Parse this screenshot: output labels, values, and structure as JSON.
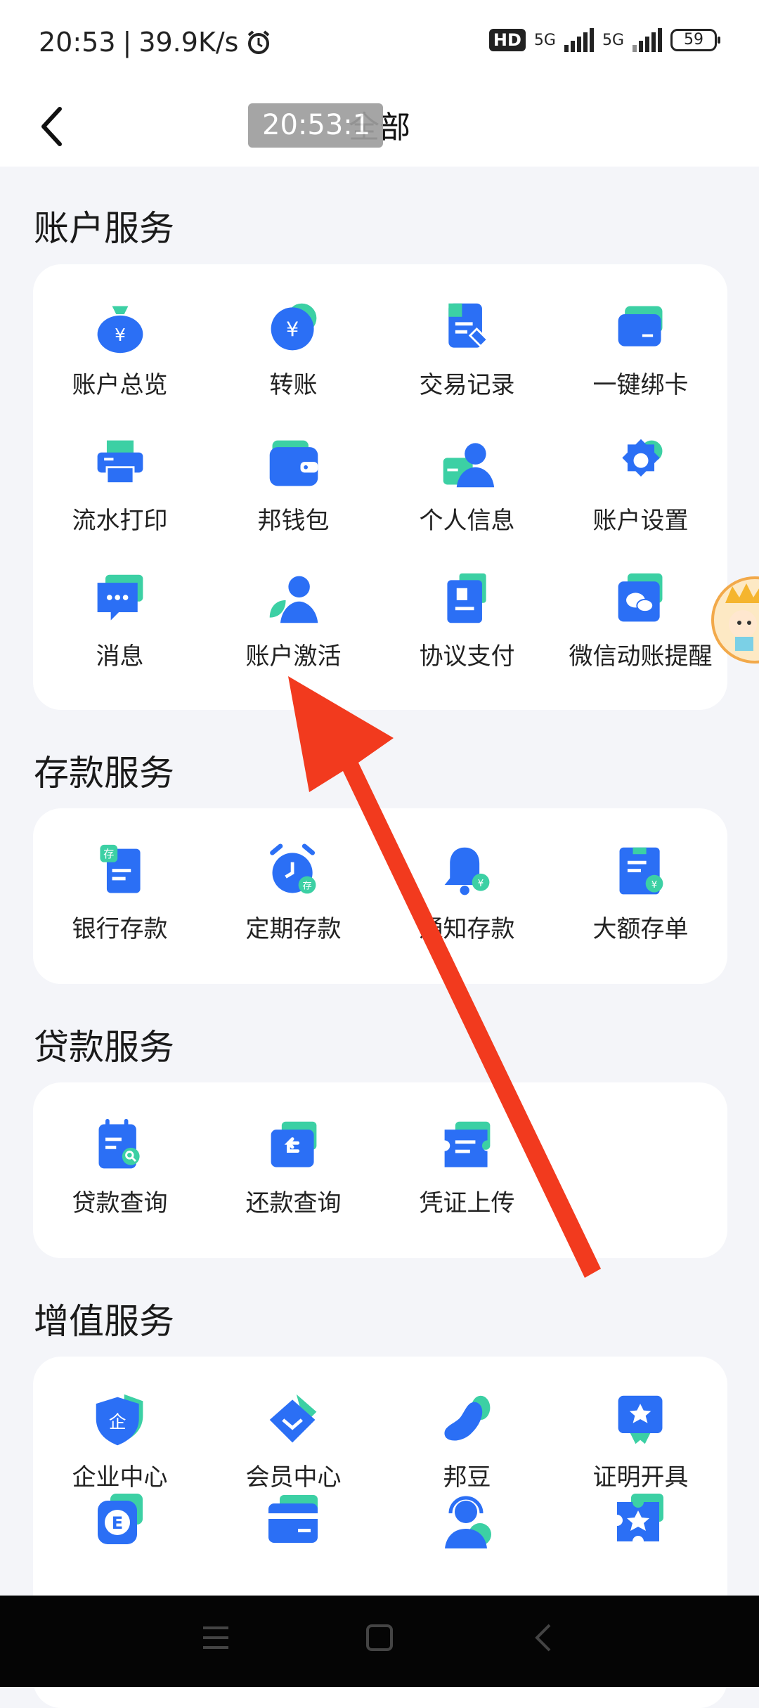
{
  "status_bar": {
    "time": "20:53",
    "speed": "39.9K/s",
    "hd_label": "HD",
    "net1": "5G",
    "net2": "5G",
    "battery": "59"
  },
  "nav": {
    "title": "全部",
    "time_overlay": "20:53:1"
  },
  "sections": [
    {
      "title": "账户服务",
      "items": [
        {
          "label": "账户总览",
          "icon": "money-bag-icon"
        },
        {
          "label": "转账",
          "icon": "yuan-coin-icon"
        },
        {
          "label": "交易记录",
          "icon": "document-edit-icon"
        },
        {
          "label": "一键绑卡",
          "icon": "card-icon"
        },
        {
          "label": "流水打印",
          "icon": "printer-icon"
        },
        {
          "label": "邦钱包",
          "icon": "wallet-icon"
        },
        {
          "label": "个人信息",
          "icon": "profile-icon"
        },
        {
          "label": "账户设置",
          "icon": "gear-icon"
        },
        {
          "label": "消息",
          "icon": "message-icon"
        },
        {
          "label": "账户激活",
          "icon": "user-leaf-icon"
        },
        {
          "label": "协议支付",
          "icon": "agreement-icon"
        },
        {
          "label": "微信动账提醒",
          "icon": "wechat-icon"
        }
      ]
    },
    {
      "title": "存款服务",
      "items": [
        {
          "label": "银行存款",
          "icon": "deposit-icon"
        },
        {
          "label": "定期存款",
          "icon": "alarm-clock-icon"
        },
        {
          "label": "通知存款",
          "icon": "bell-icon"
        },
        {
          "label": "大额存单",
          "icon": "certificate-icon"
        }
      ]
    },
    {
      "title": "贷款服务",
      "items": [
        {
          "label": "贷款查询",
          "icon": "loan-search-icon"
        },
        {
          "label": "还款查询",
          "icon": "repay-icon"
        },
        {
          "label": "凭证上传",
          "icon": "voucher-icon"
        }
      ]
    },
    {
      "title": "增值服务",
      "items": [
        {
          "label": "企业中心",
          "icon": "shield-icon"
        },
        {
          "label": "会员中心",
          "icon": "diamond-icon"
        },
        {
          "label": "邦豆",
          "icon": "bean-icon"
        },
        {
          "label": "证明开具",
          "icon": "proof-icon"
        },
        {
          "label": "",
          "icon": "e-coin-icon"
        },
        {
          "label": "",
          "icon": "bank-card-icon"
        },
        {
          "label": "",
          "icon": "customer-service-icon"
        },
        {
          "label": "",
          "icon": "star-puzzle-icon"
        }
      ]
    }
  ],
  "colors": {
    "primary_blue": "#2b6ff5",
    "accent_teal": "#3cd0a4",
    "arrow_red": "#f23a1e",
    "background": "#f4f5f9"
  }
}
